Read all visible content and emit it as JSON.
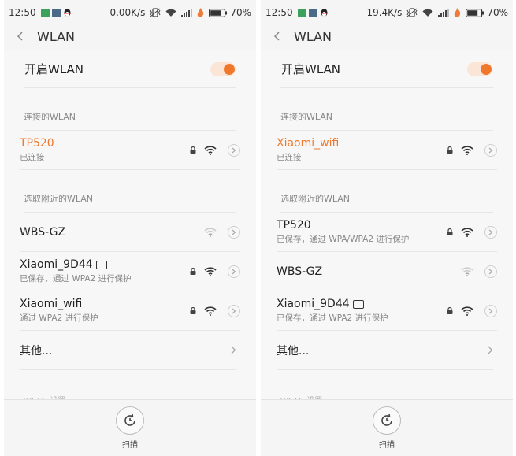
{
  "colors": {
    "accent": "#f0782c",
    "divider": "#e6e6e6"
  },
  "left": {
    "status": {
      "time": "12:50",
      "speed": "0.00K/s",
      "battery": "70%"
    },
    "title": "WLAN",
    "toggle_label": "开启WLAN",
    "connected_section": "连接的WLAN",
    "connected": {
      "name": "TP520",
      "sub": "已连接"
    },
    "nearby_section": "选取附近的WLAN",
    "nearby": [
      {
        "name": "WBS-GZ",
        "sub": ""
      },
      {
        "name": "Xiaomi_9D44",
        "sub": "已保存，通过 WPA2 进行保护"
      },
      {
        "name": "Xiaomi_wifi",
        "sub": "通过 WPA2 进行保护"
      }
    ],
    "other_label": "其他...",
    "settings_section": "WLAN 设置",
    "scan_label": "扫描"
  },
  "right": {
    "status": {
      "time": "12:50",
      "speed": "19.4K/s",
      "battery": "70%"
    },
    "title": "WLAN",
    "toggle_label": "开启WLAN",
    "connected_section": "连接的WLAN",
    "connected": {
      "name": "Xiaomi_wifi",
      "sub": "已连接"
    },
    "nearby_section": "选取附近的WLAN",
    "nearby": [
      {
        "name": "TP520",
        "sub": "已保存，通过 WPA/WPA2 进行保护"
      },
      {
        "name": "WBS-GZ",
        "sub": ""
      },
      {
        "name": "Xiaomi_9D44",
        "sub": "已保存，通过 WPA2 进行保护"
      }
    ],
    "other_label": "其他...",
    "settings_section": "WLAN 设置",
    "scan_label": "扫描"
  },
  "icons": [
    "back-arrow-icon",
    "lock-icon",
    "wifi-icon",
    "chevron-right-icon",
    "scan-icon",
    "mi-router-icon"
  ]
}
